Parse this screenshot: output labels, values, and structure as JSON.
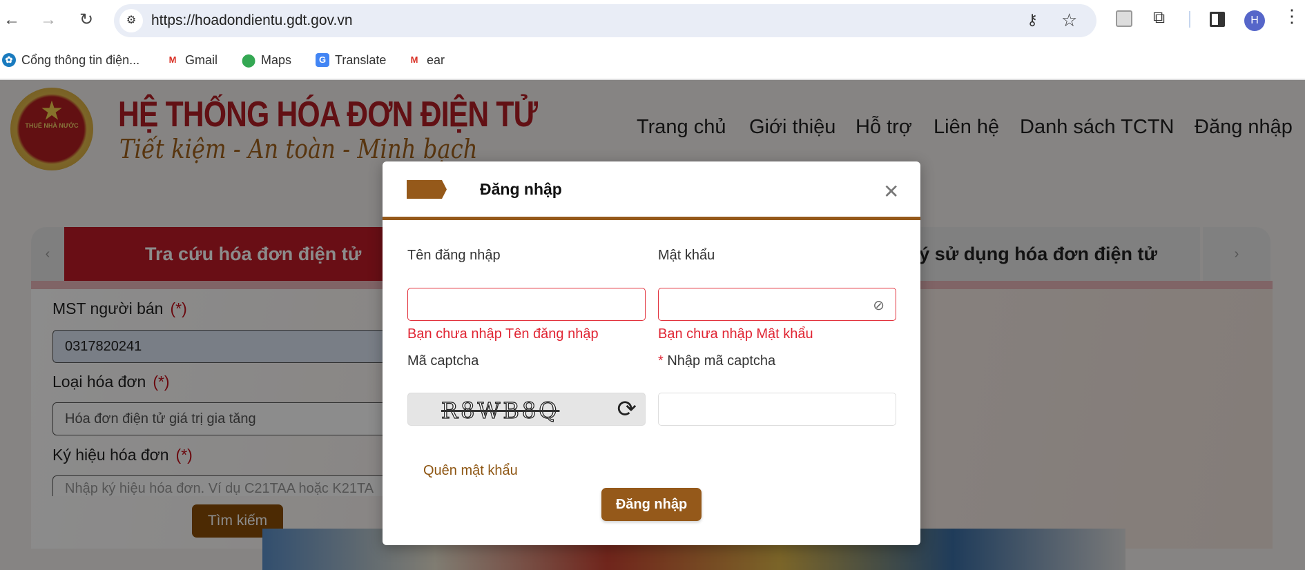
{
  "browser": {
    "url": "https://hoadondientu.gdt.gov.vn",
    "profile_initial": "H",
    "bookmarks": [
      {
        "label": "Cổng thông tin điện...",
        "icon": "globe-icon"
      },
      {
        "label": "Gmail",
        "icon": "gmail-icon"
      },
      {
        "label": "Maps",
        "icon": "maps-icon"
      },
      {
        "label": "Translate",
        "icon": "translate-icon"
      },
      {
        "label": "ear",
        "icon": "gmail-icon"
      }
    ]
  },
  "header": {
    "logo_text": "THUẾ NHÀ NƯỚC",
    "title": "HỆ THỐNG HÓA ĐƠN ĐIỆN TỬ",
    "slogan": "Tiết kiệm - An toàn - Minh bạch",
    "nav": [
      "Trang chủ",
      "Giới thiệu",
      "Hỗ trợ",
      "Liên hệ",
      "Danh sách TCTN",
      "Đăng nhập"
    ]
  },
  "tabs": {
    "active": "Tra cứu hóa đơn điện tử",
    "register": "Đăng ký sử dụng hóa đơn điện tử"
  },
  "search_form": {
    "mst_label": "MST người bán",
    "required_mark": "(*)",
    "mst_value": "0317820241",
    "type_label": "Loại hóa đơn",
    "type_value": "Hóa đơn điện tử giá trị gia tăng",
    "symbol_label": "Ký hiệu hóa đơn",
    "symbol_placeholder": "Nhập ký hiệu hóa đơn. Ví dụ C21TAA hoặc K21TA",
    "search_button": "Tìm kiếm"
  },
  "login_dialog": {
    "title": "Đăng nhập",
    "username_label": "Tên đăng nhập",
    "password_label": "Mật khẩu",
    "username_error": "Bạn chưa nhập Tên đăng nhập",
    "password_error": "Bạn chưa nhập Mật khẩu",
    "captcha_label": "Mã captcha",
    "captcha_input_required": "*",
    "captcha_input_label": "Nhập mã captcha",
    "captcha_text": "R8WB8Q",
    "forgot_password": "Quên mật khẩu",
    "submit": "Đăng nhập"
  },
  "colors": {
    "brand_brown": "#95591a",
    "brand_red": "#c01a27",
    "error": "#e02533"
  }
}
